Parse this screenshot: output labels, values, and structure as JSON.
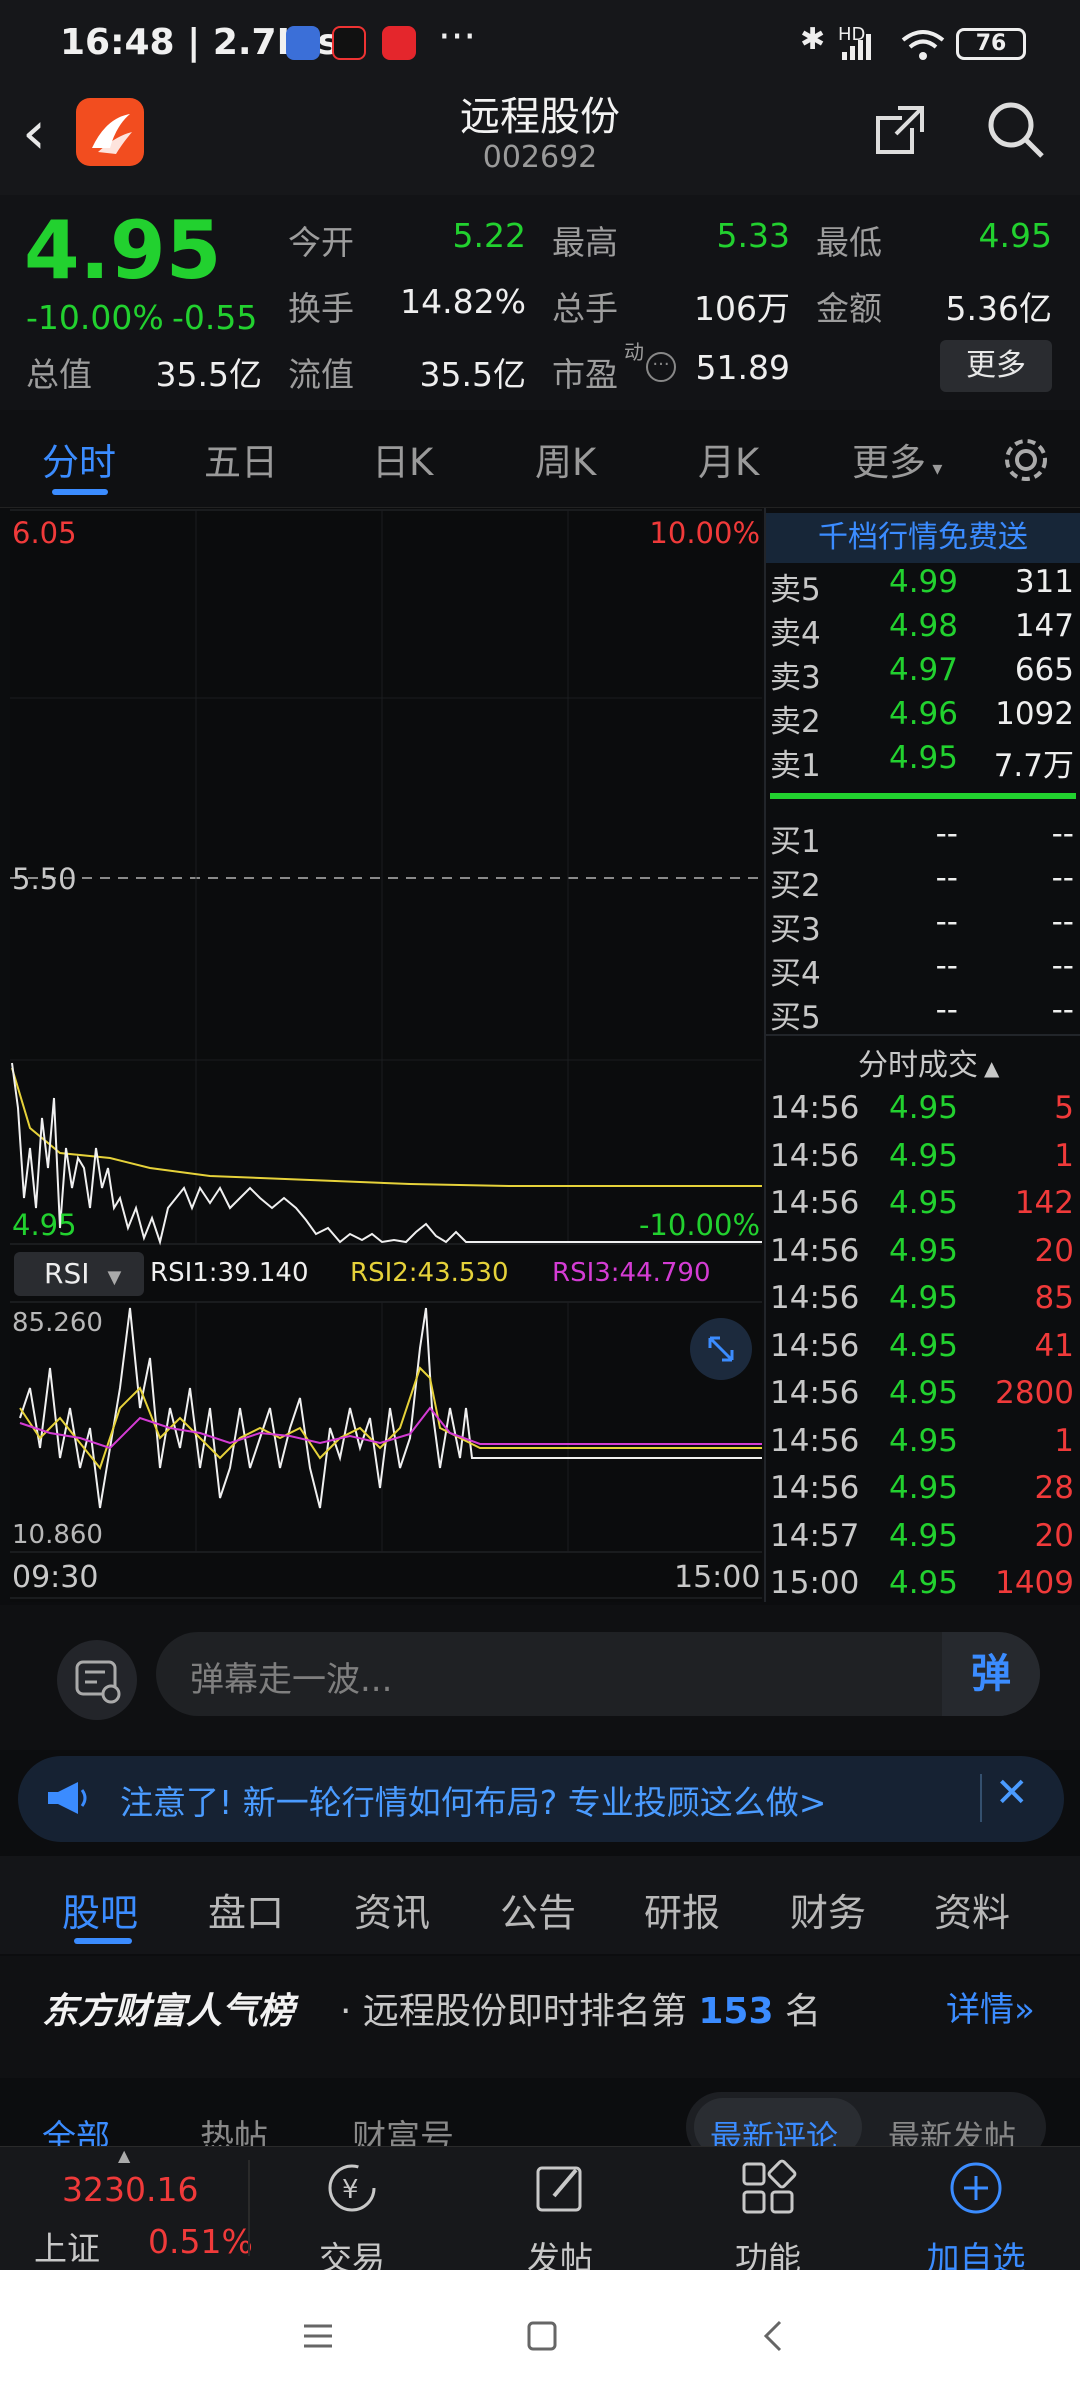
{
  "status": {
    "time": "16:48",
    "speed": "2.7K/s",
    "battery": "76",
    "net": "HD"
  },
  "header": {
    "name": "远程股份",
    "code": "002692"
  },
  "quote": {
    "price": "4.95",
    "change_pct": "-10.00%",
    "change_abs": "-0.55",
    "open_label": "今开",
    "open": "5.22",
    "high_label": "最高",
    "high": "5.33",
    "low_label": "最低",
    "low": "4.95",
    "turnover_label": "换手",
    "turnover": "14.82%",
    "volume_label": "总手",
    "volume": "106万",
    "amount_label": "金额",
    "amount": "5.36亿",
    "mcap_label": "总值",
    "mcap": "35.5亿",
    "float_label": "流值",
    "float": "35.5亿",
    "pe_label": "市盈",
    "pe_sup": "动",
    "pe": "51.89",
    "more": "更多"
  },
  "tabs": [
    "分时",
    "五日",
    "日K",
    "周K",
    "月K",
    "更多"
  ],
  "chart": {
    "price_top": "6.05",
    "pct_top": "10.00%",
    "price_mid": "5.50",
    "price_bottom": "4.95",
    "pct_bottom": "-10.00%",
    "time_start": "09:30",
    "time_end": "15:00",
    "indicator": "RSI",
    "rsi1": "RSI1:39.140",
    "rsi2": "RSI2:43.530",
    "rsi3": "RSI3:44.790",
    "rsi_max": "85.260",
    "rsi_min": "10.860"
  },
  "orderbook": {
    "header": "千档行情免费送",
    "sells": [
      {
        "label": "卖5",
        "price": "4.99",
        "vol": "311"
      },
      {
        "label": "卖4",
        "price": "4.98",
        "vol": "147"
      },
      {
        "label": "卖3",
        "price": "4.97",
        "vol": "665"
      },
      {
        "label": "卖2",
        "price": "4.96",
        "vol": "1092"
      },
      {
        "label": "卖1",
        "price": "4.95",
        "vol": "7.7万"
      }
    ],
    "buys": [
      {
        "label": "买1",
        "price": "--",
        "vol": "--"
      },
      {
        "label": "买2",
        "price": "--",
        "vol": "--"
      },
      {
        "label": "买3",
        "price": "--",
        "vol": "--"
      },
      {
        "label": "买4",
        "price": "--",
        "vol": "--"
      },
      {
        "label": "买5",
        "price": "--",
        "vol": "--"
      }
    ],
    "trades_title": "分时成交",
    "trades": [
      {
        "time": "14:56",
        "price": "4.95",
        "vol": "5"
      },
      {
        "time": "14:56",
        "price": "4.95",
        "vol": "1"
      },
      {
        "time": "14:56",
        "price": "4.95",
        "vol": "142"
      },
      {
        "time": "14:56",
        "price": "4.95",
        "vol": "20"
      },
      {
        "time": "14:56",
        "price": "4.95",
        "vol": "85"
      },
      {
        "time": "14:56",
        "price": "4.95",
        "vol": "41"
      },
      {
        "time": "14:56",
        "price": "4.95",
        "vol": "2800"
      },
      {
        "time": "14:56",
        "price": "4.95",
        "vol": "1"
      },
      {
        "time": "14:56",
        "price": "4.95",
        "vol": "28"
      },
      {
        "time": "14:57",
        "price": "4.95",
        "vol": "20"
      },
      {
        "time": "15:00",
        "price": "4.95",
        "vol": "1409"
      }
    ]
  },
  "comment": {
    "placeholder": "弹幕走一波...",
    "danmu": "弹"
  },
  "notice": {
    "text": "注意了! 新一轮行情如何布局? 专业投顾这么做>"
  },
  "sections": [
    "股吧",
    "盘口",
    "资讯",
    "公告",
    "研报",
    "财务",
    "资料"
  ],
  "rank": {
    "brand": "东方财富人气榜",
    "prefix": "· 远程股份即时排名第",
    "num": "153",
    "suffix": "名",
    "detail": "详情"
  },
  "subtabs": [
    "全部",
    "热帖",
    "财富号"
  ],
  "sort": [
    "最新评论",
    "最新发帖"
  ],
  "toolbar": {
    "index": "3230.16",
    "index_name": "上证",
    "index_pct": "0.51%",
    "trade": "交易",
    "post": "发帖",
    "func": "功能",
    "add": "加自选"
  },
  "colors": {
    "green": "#22d12f",
    "red": "#f03a3a",
    "blue": "#3b8cff"
  }
}
